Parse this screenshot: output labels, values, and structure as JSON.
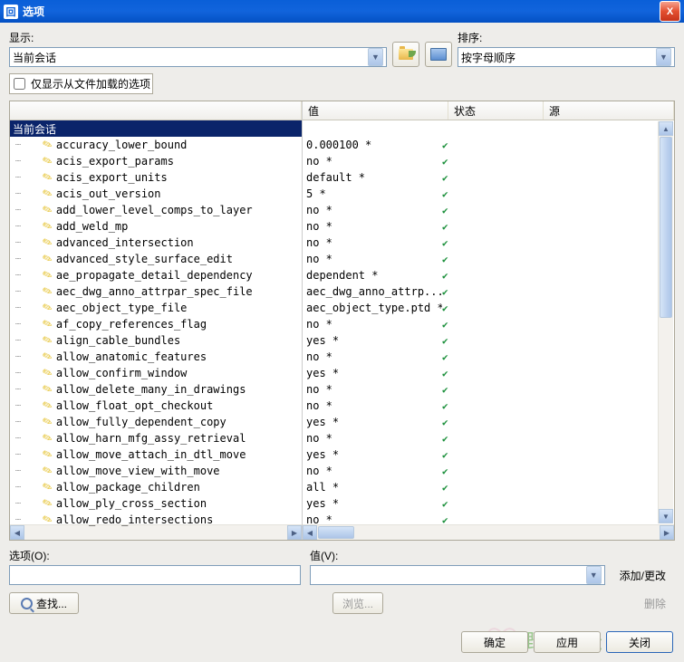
{
  "window": {
    "title": "选项"
  },
  "labels": {
    "show": "显示:",
    "sort": "排序:",
    "onlyFile": "仅显示从文件加载的选项",
    "option": "选项(O):",
    "value": "值(V):",
    "find": "查找...",
    "browse": "浏览...",
    "addChange": "添加/更改",
    "delete": "删除",
    "ok": "确定",
    "apply": "应用",
    "close": "关闭"
  },
  "show_value": "当前会话",
  "sort_value": "按字母顺序",
  "cols": {
    "name": "",
    "value": "值",
    "status": "状态",
    "source": "源"
  },
  "category": "当前会话",
  "rows": [
    {
      "n": "accuracy_lower_bound",
      "v": "0.000100 *"
    },
    {
      "n": "acis_export_params",
      "v": "no *"
    },
    {
      "n": "acis_export_units",
      "v": "default *"
    },
    {
      "n": "acis_out_version",
      "v": "5 *"
    },
    {
      "n": "add_lower_level_comps_to_layer",
      "v": "no *"
    },
    {
      "n": "add_weld_mp",
      "v": "no *"
    },
    {
      "n": "advanced_intersection",
      "v": "no *"
    },
    {
      "n": "advanced_style_surface_edit",
      "v": "no *"
    },
    {
      "n": "ae_propagate_detail_dependency",
      "v": "dependent *"
    },
    {
      "n": "aec_dwg_anno_attrpar_spec_file",
      "v": "aec_dwg_anno_attrp..."
    },
    {
      "n": "aec_object_type_file",
      "v": "aec_object_type.ptd *"
    },
    {
      "n": "af_copy_references_flag",
      "v": "no *"
    },
    {
      "n": "align_cable_bundles",
      "v": "yes *"
    },
    {
      "n": "allow_anatomic_features",
      "v": "no *"
    },
    {
      "n": "allow_confirm_window",
      "v": "yes *"
    },
    {
      "n": "allow_delete_many_in_drawings",
      "v": "no *"
    },
    {
      "n": "allow_float_opt_checkout",
      "v": "no *"
    },
    {
      "n": "allow_fully_dependent_copy",
      "v": "yes *"
    },
    {
      "n": "allow_harn_mfg_assy_retrieval",
      "v": "no *"
    },
    {
      "n": "allow_move_attach_in_dtl_move",
      "v": "yes *"
    },
    {
      "n": "allow_move_view_with_move",
      "v": "no *"
    },
    {
      "n": "allow_package_children",
      "v": "all *"
    },
    {
      "n": "allow_ply_cross_section",
      "v": "yes *"
    },
    {
      "n": "allow_redo_intersections",
      "v": "no *"
    }
  ],
  "watermark": "野火论坛"
}
